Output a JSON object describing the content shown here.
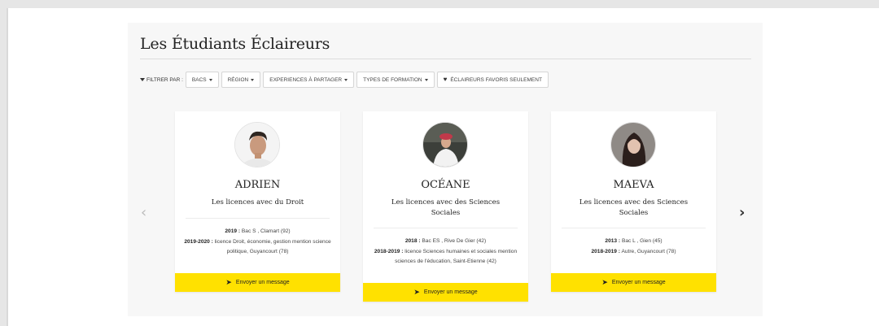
{
  "title": "Les Étudiants Éclaireurs",
  "filters": {
    "label": "FILTRER PAR :",
    "buttons": [
      "BACS",
      "RÉGION",
      "EXPERIENCES À PARTAGER",
      "TYPES DE FORMATION"
    ],
    "favorites": "ÉCLAIREURS FAVORIS SEULEMENT"
  },
  "cta_label": "Envoyer un message",
  "cards": [
    {
      "name": "ADRIEN",
      "field": "Les licences avec du Droit",
      "lines": [
        {
          "year": "2019 :",
          "text": "Bac S , Clamart (92)"
        },
        {
          "year": "2019-2020 :",
          "text": "licence Droit, économie, gestion mention science politique, Guyancourt (78)"
        }
      ]
    },
    {
      "name": "OCÉANE",
      "field": "Les licences avec des Sciences Sociales",
      "lines": [
        {
          "year": "2018 :",
          "text": "Bac ES , Rive De Gier (42)"
        },
        {
          "year": "2018-2019 :",
          "text": "licence Sciences humaines et sociales mention sciences de l'éducation, Saint-Etienne (42)"
        }
      ]
    },
    {
      "name": "MAEVA",
      "field": "Les licences avec des Sciences Sociales",
      "lines": [
        {
          "year": "2013 :",
          "text": "Bac L , Gien (45)"
        },
        {
          "year": "2018-2019 :",
          "text": "Autre, Guyancourt (78)"
        }
      ]
    }
  ]
}
